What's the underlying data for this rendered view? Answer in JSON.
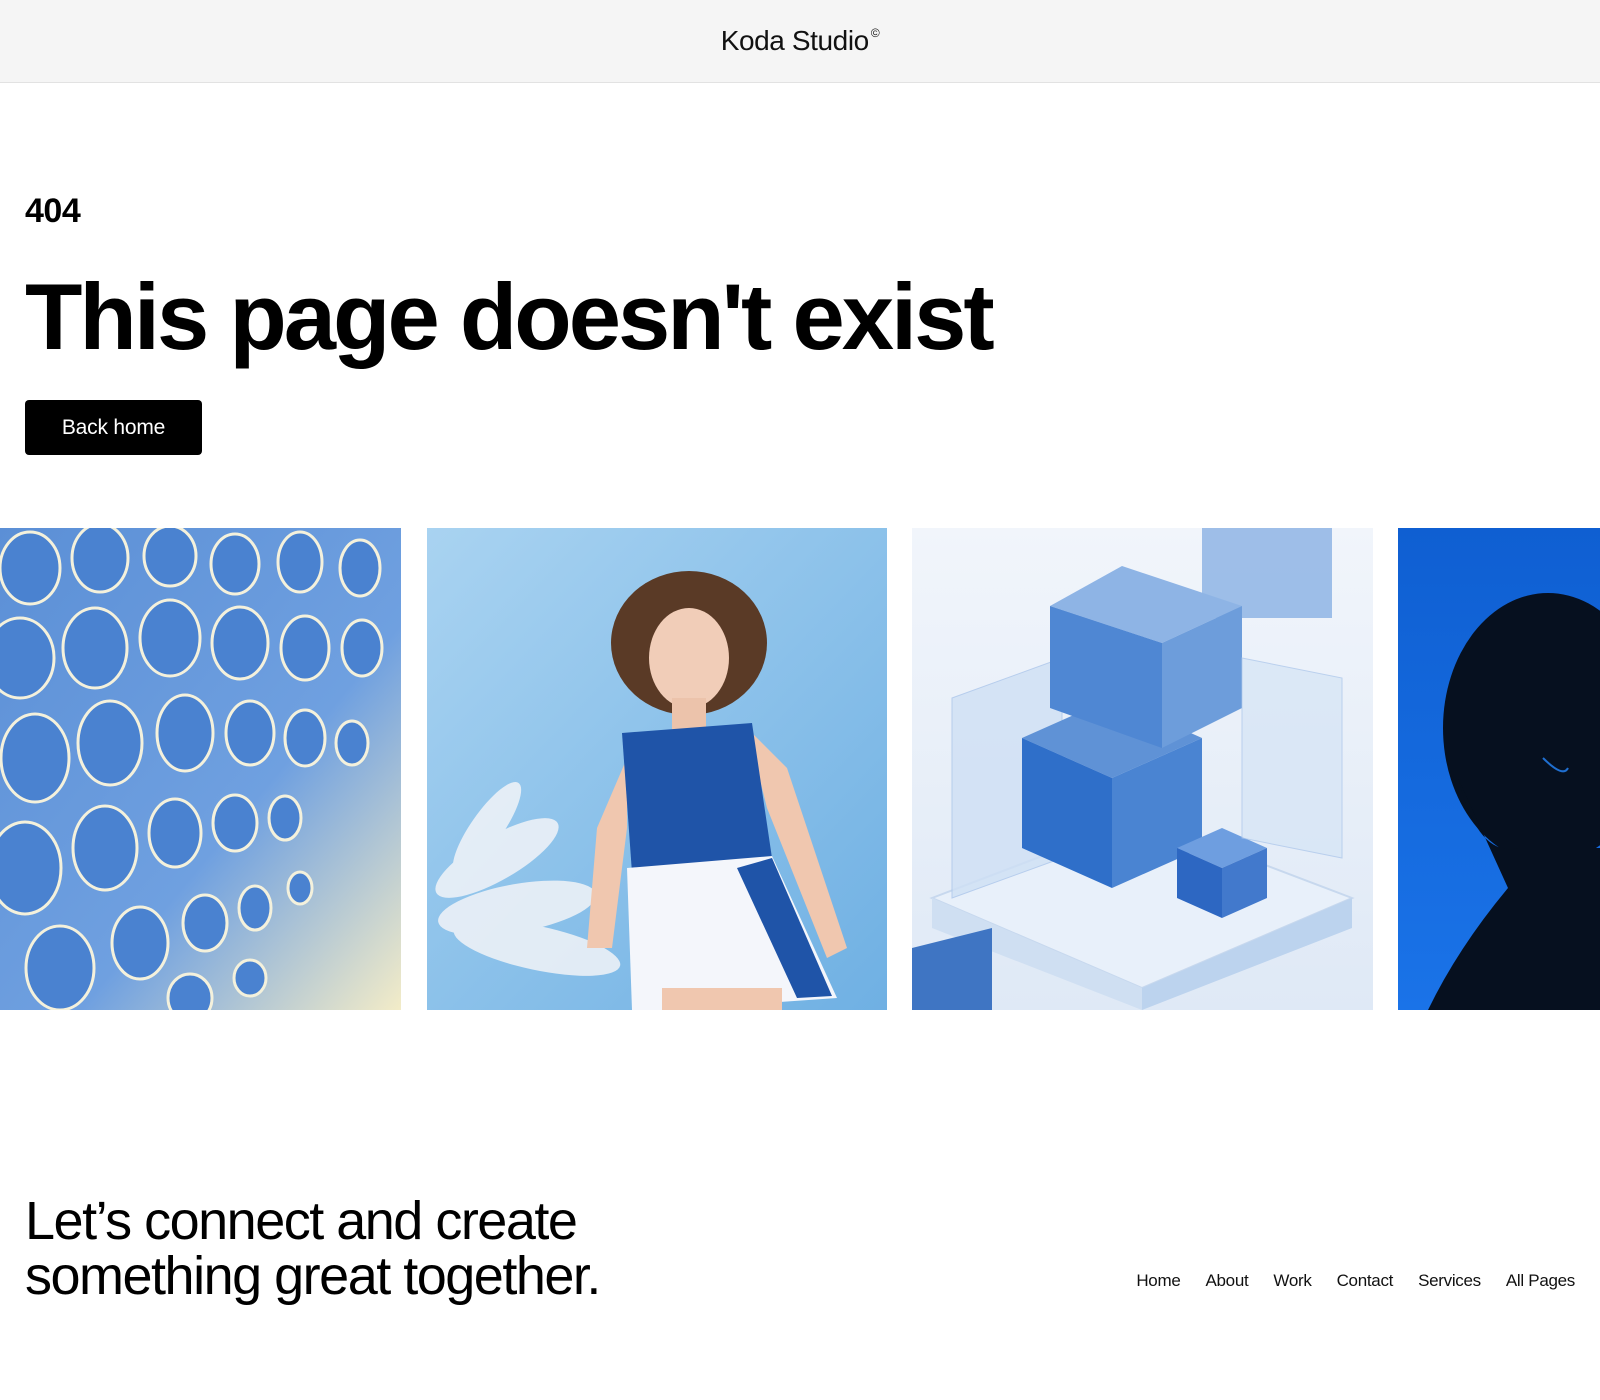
{
  "header": {
    "brand_name": "Koda Studio",
    "brand_mark": "©"
  },
  "hero": {
    "error_code": "404",
    "headline": "This page doesn't exist",
    "back_button_label": "Back home"
  },
  "gallery": [
    {
      "name": "gallery-image-blue-foam-cells",
      "icon": "abstract-cells-image"
    },
    {
      "name": "gallery-image-woman-in-blue",
      "icon": "portrait-photo-image"
    },
    {
      "name": "gallery-image-ice-cubes",
      "icon": "3d-cubes-image"
    },
    {
      "name": "gallery-image-silhouette",
      "icon": "silhouette-image"
    }
  ],
  "footer": {
    "cta_line_1": "Let’s connect and create",
    "cta_line_2": "something great together.",
    "nav": [
      "Home",
      "About",
      "Work",
      "Contact",
      "Services",
      "All Pages"
    ]
  },
  "colors": {
    "header_bg": "#f5f5f5",
    "button_bg": "#000000",
    "accent_blue": "#2f6fc9",
    "text": "#000000"
  }
}
